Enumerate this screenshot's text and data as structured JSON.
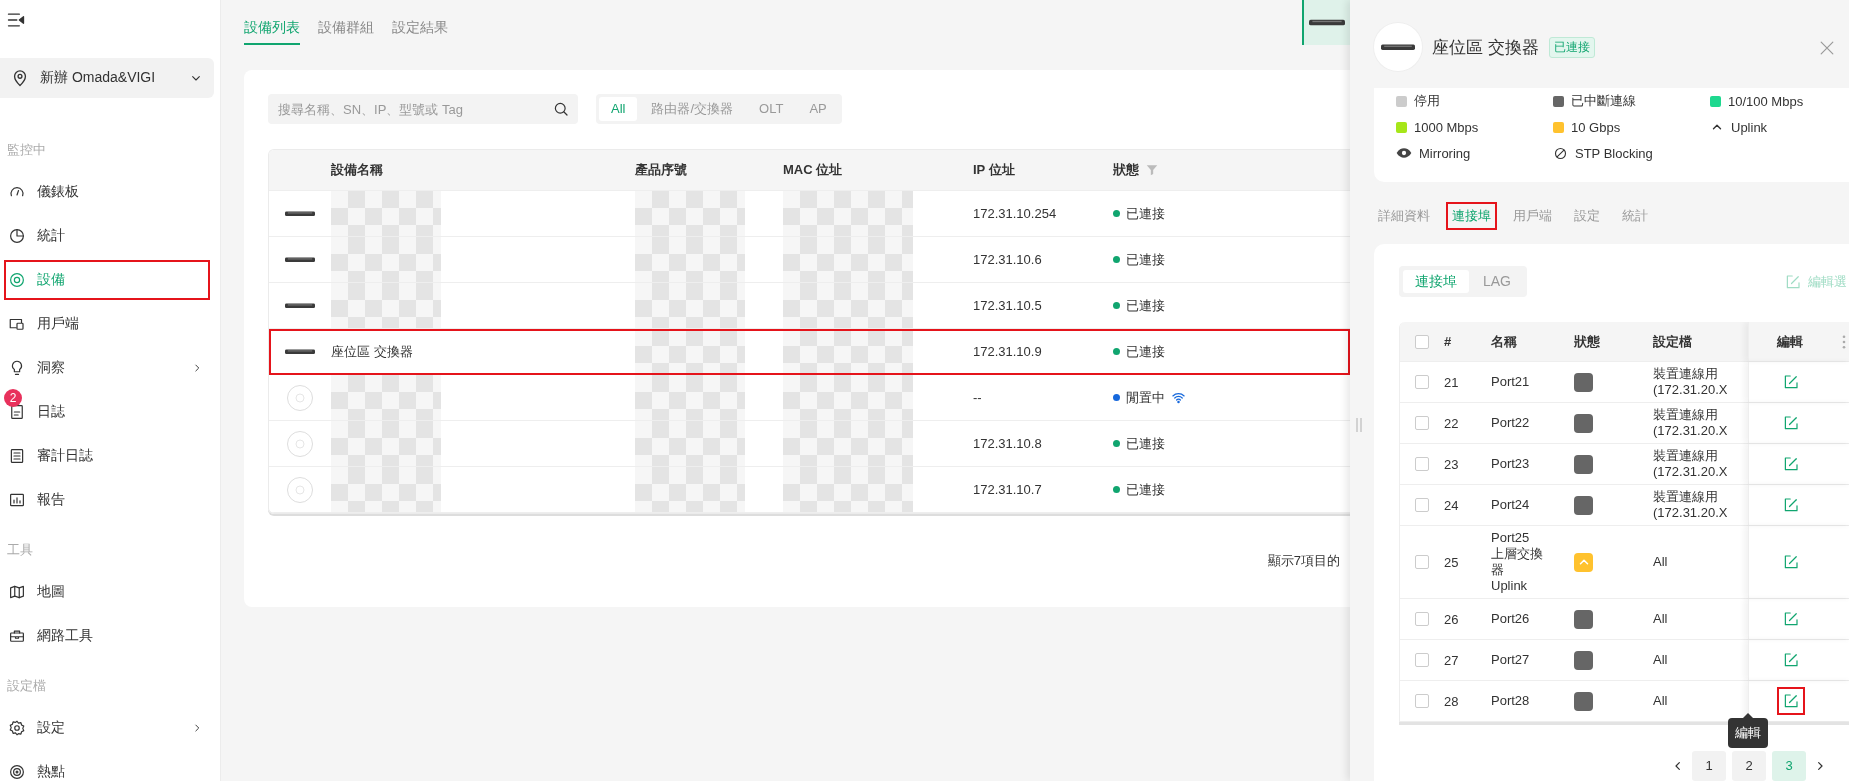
{
  "sidebar": {
    "site": "新辦 Omada&VIGI",
    "sections": [
      {
        "title": "監控中",
        "items": [
          {
            "kind": "gauge",
            "label": "儀錶板",
            "selected": false,
            "annotated": false,
            "expandable": false
          },
          {
            "kind": "pie",
            "label": "統計",
            "selected": false,
            "annotated": false,
            "expandable": false
          },
          {
            "kind": "target",
            "label": "設備",
            "selected": true,
            "annotated": true,
            "expandable": false
          },
          {
            "kind": "devices",
            "label": "用戶端",
            "selected": false,
            "annotated": false,
            "expandable": false
          },
          {
            "kind": "bulb",
            "label": "洞察",
            "selected": false,
            "annotated": false,
            "expandable": true
          },
          {
            "kind": "log",
            "label": "日誌",
            "selected": false,
            "annotated": false,
            "expandable": false,
            "badge": "2"
          },
          {
            "kind": "list",
            "label": "審計日誌",
            "selected": false,
            "annotated": false,
            "expandable": false
          },
          {
            "kind": "chart",
            "label": "報告",
            "selected": false,
            "annotated": false,
            "expandable": false
          }
        ]
      },
      {
        "title": "工具",
        "items": [
          {
            "kind": "map",
            "label": "地圖",
            "selected": false,
            "annotated": false,
            "expandable": false
          },
          {
            "kind": "toolbox",
            "label": "網路工具",
            "selected": false,
            "annotated": false,
            "expandable": false
          }
        ]
      },
      {
        "title": "設定檔",
        "items": [
          {
            "kind": "gear",
            "label": "設定",
            "selected": false,
            "annotated": false,
            "expandable": true
          },
          {
            "kind": "hotspot",
            "label": "熱點",
            "selected": false,
            "annotated": false,
            "expandable": false
          }
        ]
      }
    ]
  },
  "main": {
    "tabs": [
      {
        "label": "設備列表",
        "selected": true
      },
      {
        "label": "設備群組",
        "selected": false
      },
      {
        "label": "設定結果",
        "selected": false
      }
    ],
    "search": {
      "placeholder": "搜尋名稱、SN、IP、型號或 Tag"
    },
    "filters": [
      {
        "label": "All",
        "selected": true
      },
      {
        "label": "路由器/交換器",
        "selected": false
      },
      {
        "label": "OLT",
        "selected": false
      },
      {
        "label": "AP",
        "selected": false
      }
    ],
    "table": {
      "columns": [
        "設備名稱",
        "產品序號",
        "MAC 位址",
        "IP 位址",
        "狀態"
      ],
      "rows": [
        {
          "kind": "switch",
          "ip": "172.31.10.254",
          "status": {
            "label": "已連接",
            "color": "#10a56f"
          },
          "wireless": false,
          "annotated": false
        },
        {
          "kind": "switch",
          "ip": "172.31.10.6",
          "status": {
            "label": "已連接",
            "color": "#10a56f"
          },
          "wireless": false,
          "annotated": false
        },
        {
          "kind": "switch",
          "ip": "172.31.10.5",
          "status": {
            "label": "已連接",
            "color": "#10a56f"
          },
          "wireless": false,
          "annotated": false
        },
        {
          "kind": "switch",
          "name": "座位區 交換器",
          "ip": "172.31.10.9",
          "status": {
            "label": "已連接",
            "color": "#10a56f"
          },
          "wireless": false,
          "annotated": true
        },
        {
          "kind": "ap",
          "ip": "--",
          "status": {
            "label": "閒置中",
            "color": "#1668dc"
          },
          "wireless": true,
          "annotated": false
        },
        {
          "kind": "ap",
          "ip": "172.31.10.8",
          "status": {
            "label": "已連接",
            "color": "#10a56f"
          },
          "wireless": false,
          "annotated": false
        },
        {
          "kind": "ap",
          "ip": "172.31.10.7",
          "status": {
            "label": "已連接",
            "color": "#10a56f"
          },
          "wireless": false,
          "annotated": false
        }
      ]
    },
    "footer": "顯示7項目的"
  },
  "drawer": {
    "title": "座位區 交換器",
    "badge": "已連接",
    "legend": [
      {
        "kind": "swatch",
        "label": "停用",
        "color": "#cccccc"
      },
      {
        "kind": "swatch",
        "label": "已中斷連線",
        "color": "#666666"
      },
      {
        "kind": "swatch",
        "label": "10/100 Mbps",
        "color": "#1ed88f"
      },
      {
        "kind": "swatch",
        "label": "1000 Mbps",
        "color": "#a6e619"
      },
      {
        "kind": "swatch",
        "label": "10 Gbps",
        "color": "#ffc22e"
      },
      {
        "kind": "uplink",
        "label": "Uplink"
      },
      {
        "kind": "mirroring",
        "label": "Mirroring"
      },
      {
        "kind": "blocking",
        "label": "STP Blocking"
      }
    ],
    "tabs": [
      {
        "label": "詳細資料",
        "selected": false,
        "annotated": false
      },
      {
        "label": "連接埠",
        "selected": true,
        "annotated": true
      },
      {
        "label": "用戶端",
        "selected": false,
        "annotated": false
      },
      {
        "label": "設定",
        "selected": false,
        "annotated": false
      },
      {
        "label": "統計",
        "selected": false,
        "annotated": false
      }
    ],
    "subtabs": [
      {
        "label": "連接埠",
        "selected": true
      },
      {
        "label": "LAG",
        "selected": false
      }
    ],
    "edit_selected": {
      "label": "編輯選",
      "disabled": true
    },
    "ports": {
      "columns": [
        "#",
        "名稱",
        "狀態",
        "設定檔",
        "編輯"
      ],
      "select_all_checked": false,
      "rows": [
        {
          "number": "21",
          "name": "Port21",
          "status": {
            "kind": "disconnected",
            "color": "#666666"
          },
          "profile": "裝置連線用\n(172.31.20.X",
          "checked": false,
          "annotated": false
        },
        {
          "number": "22",
          "name": "Port22",
          "status": {
            "kind": "disconnected",
            "color": "#666666"
          },
          "profile": "裝置連線用\n(172.31.20.X",
          "checked": false,
          "annotated": false
        },
        {
          "number": "23",
          "name": "Port23",
          "status": {
            "kind": "disconnected",
            "color": "#666666"
          },
          "profile": "裝置連線用\n(172.31.20.X",
          "checked": false,
          "annotated": false
        },
        {
          "number": "24",
          "name": "Port24",
          "status": {
            "kind": "disconnected",
            "color": "#666666"
          },
          "profile": "裝置連線用\n(172.31.20.X",
          "checked": false,
          "annotated": false
        },
        {
          "number": "25",
          "name": "Port25",
          "description": "上層交換器",
          "role": "Uplink",
          "status": {
            "kind": "uplink",
            "color": "#ffc22e"
          },
          "profile": "All",
          "checked": false,
          "annotated": false
        },
        {
          "number": "26",
          "name": "Port26",
          "status": {
            "kind": "disconnected",
            "color": "#666666"
          },
          "profile": "All",
          "checked": false,
          "annotated": false
        },
        {
          "number": "27",
          "name": "Port27",
          "status": {
            "kind": "disconnected",
            "color": "#666666"
          },
          "profile": "All",
          "checked": false,
          "annotated": false
        },
        {
          "number": "28",
          "name": "Port28",
          "status": {
            "kind": "disconnected",
            "color": "#666666"
          },
          "profile": "All",
          "checked": false,
          "annotated": true
        }
      ]
    },
    "tooltip": "編輯",
    "pages": [
      {
        "label": "1",
        "selected": false
      },
      {
        "label": "2",
        "selected": false
      },
      {
        "label": "3",
        "selected": true
      }
    ]
  }
}
